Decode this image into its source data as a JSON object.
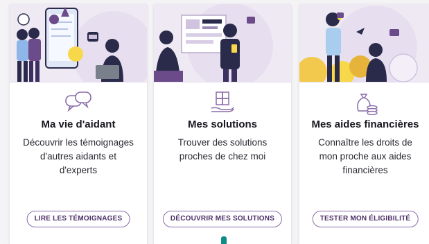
{
  "cards": [
    {
      "title": "Ma vie d'aidant",
      "description": [
        "Découvrir les témoignages",
        "d'autres aidants et",
        "d'experts"
      ],
      "button_label": "LIRE LES TÉMOIGNAGES",
      "icon": "speech-bubbles-icon",
      "illustration": "people-around-phone-illustration"
    },
    {
      "title": "Mes solutions",
      "description": [
        "Trouver des solutions",
        "proches de chez moi"
      ],
      "button_label": "DÉCOUVRIR MES SOLUTIONS",
      "icon": "puzzle-hand-icon",
      "illustration": "people-at-board-illustration"
    },
    {
      "title": "Mes aides financières",
      "description": [
        "Connaître les droits de",
        "mon proche aux aides",
        "financières"
      ],
      "button_label": "TESTER MON ÉLIGIBILITÉ",
      "icon": "money-bag-coins-icon",
      "illustration": "people-with-coins-illustration"
    }
  ],
  "colors": {
    "accent_purple": "#8a6aa8",
    "hero_background": "#efe9f3",
    "teal": "#0e8c87",
    "dark_navy": "#2a2b4a"
  }
}
